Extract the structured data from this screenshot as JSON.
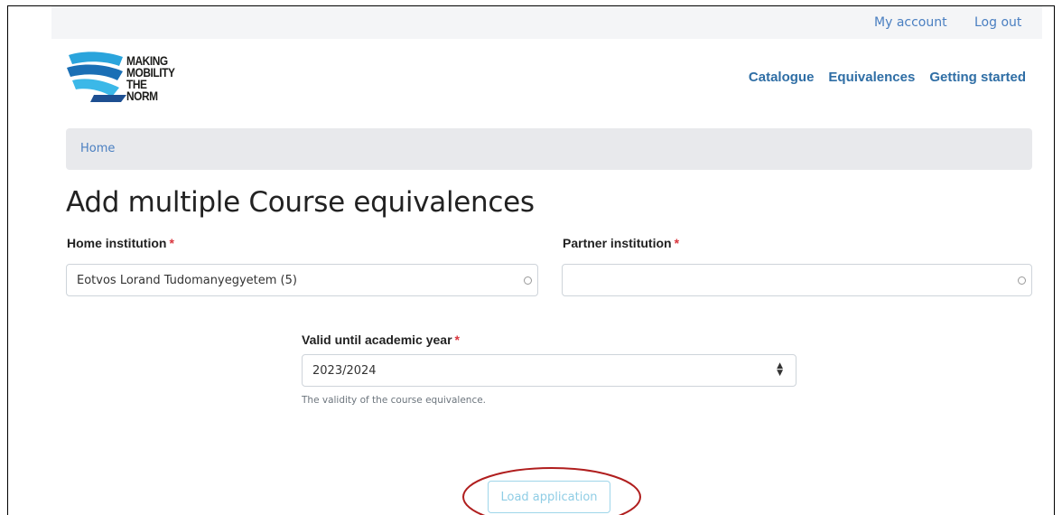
{
  "topbar": {
    "my_account": "My account",
    "log_out": "Log out"
  },
  "logo": {
    "line1": "MAKING",
    "line2": "MOBILITY",
    "line3": "THE NORM"
  },
  "nav": {
    "catalogue": "Catalogue",
    "equivalences": "Equivalences",
    "getting_started": "Getting started"
  },
  "breadcrumb": {
    "home": "Home"
  },
  "page": {
    "title": "Add multiple Course equivalences"
  },
  "form": {
    "home_institution": {
      "label": "Home institution",
      "required": "*",
      "value": "Eotvos Lorand Tudomanyegyetem (5)"
    },
    "partner_institution": {
      "label": "Partner institution",
      "required": "*",
      "value": ""
    },
    "valid_until": {
      "label": "Valid until academic year",
      "required": "*",
      "value": "2023/2024",
      "help": "The validity of the course equivalence."
    },
    "load_button": "Load application"
  },
  "colors": {
    "link": "#4a7fc1",
    "nav": "#2f6ea5",
    "required": "#d9363e",
    "annotation": "#b01e1e",
    "button_border": "#9fd6ea"
  }
}
